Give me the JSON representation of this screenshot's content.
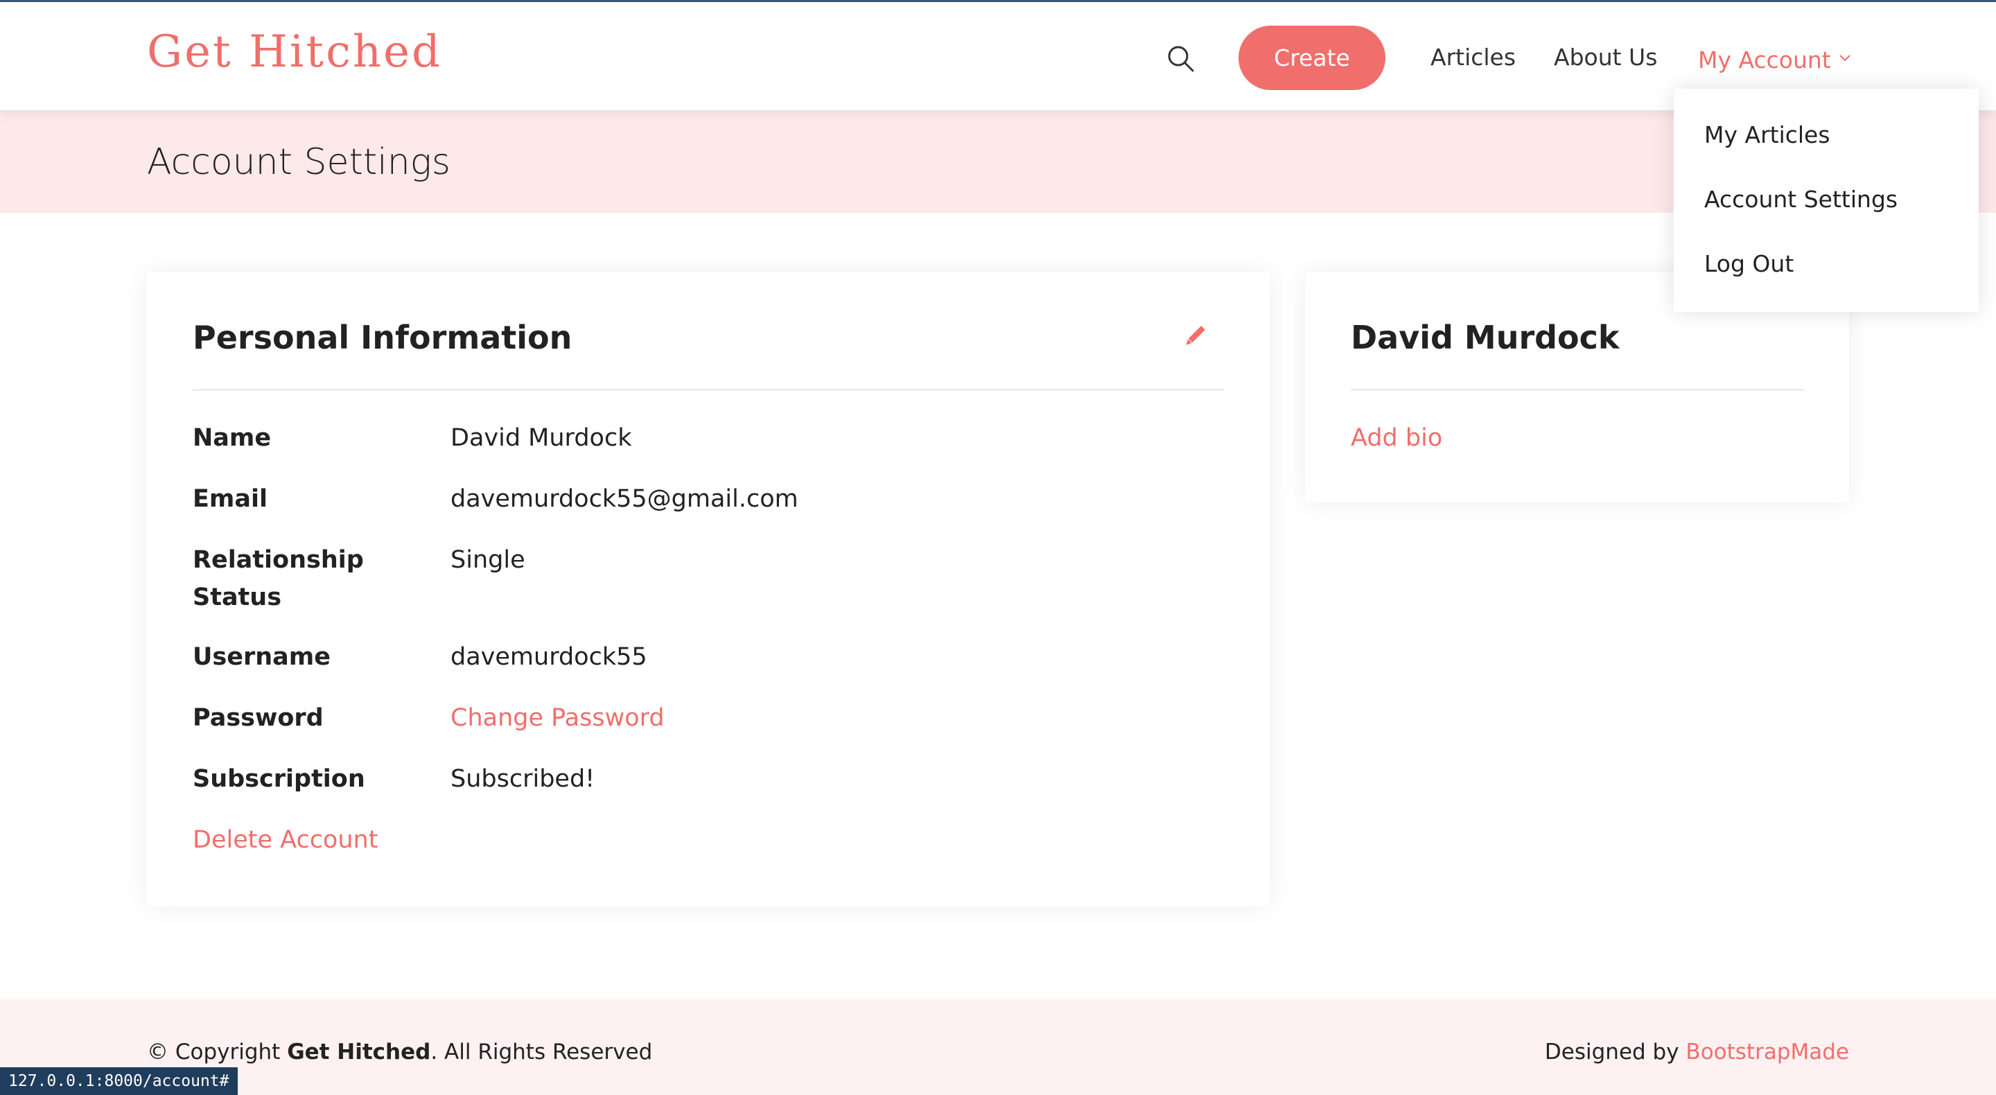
{
  "header": {
    "logo": "Get Hitched",
    "create_label": "Create",
    "nav": {
      "articles": "Articles",
      "about": "About Us",
      "account": "My Account"
    }
  },
  "dropdown": {
    "items": [
      "My Articles",
      "Account Settings",
      "Log Out"
    ]
  },
  "page": {
    "title": "Account Settings"
  },
  "personal_info": {
    "title": "Personal Information",
    "rows": [
      {
        "label": "Name",
        "value": "David Murdock"
      },
      {
        "label": "Email",
        "value": "davemurdock55@gmail.com"
      },
      {
        "label": "Relationship Status",
        "value": "Single"
      },
      {
        "label": "Username",
        "value": "davemurdock55"
      },
      {
        "label": "Password",
        "value": "Change Password"
      },
      {
        "label": "Subscription",
        "value": "Subscribed!"
      }
    ],
    "delete_label": "Delete Account"
  },
  "profile": {
    "name": "David Murdock",
    "add_bio": "Add bio"
  },
  "footer": {
    "copyright_prefix": "© Copyright ",
    "copyright_brand": "Get Hitched",
    "copyright_suffix": ". All Rights Reserved",
    "designed_prefix": "Designed by ",
    "designed_link": "BootstrapMade"
  },
  "status_bar": {
    "url": "127.0.0.1:8000/account#"
  },
  "colors": {
    "accent": "#f06e6b",
    "band": "#fde8ea",
    "footer": "#fdf1f2"
  }
}
